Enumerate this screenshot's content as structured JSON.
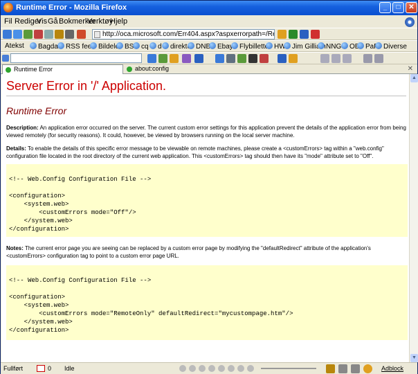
{
  "window": {
    "title": "Runtime Error - Mozilla Firefox"
  },
  "menu": [
    "Fil",
    "Rediger",
    "Vis",
    "Gå",
    "Bokmerker",
    "Verktøy",
    "Hjelp"
  ],
  "address": {
    "url": "http://oca.microsoft.com/Err404.aspx?aspxerrorpath=/ResRedir.aspx"
  },
  "bookmarks": [
    "Atekst",
    "Bagdad",
    "RSS feed",
    "Bildeler",
    "BS",
    "cq",
    "d",
    "direkte",
    "DNB",
    "Ebay",
    "Flybilletter",
    "HW",
    "Jim Gilliam",
    "NNGS",
    "OB",
    "PaP",
    "Diverse"
  ],
  "tabs": [
    {
      "label": "Runtime Error",
      "active": true
    },
    {
      "label": "about:config",
      "active": false
    }
  ],
  "page": {
    "heading": "Server Error in '/' Application.",
    "subheading": "Runtime Error",
    "description_label": "Description:",
    "description_text": "An application error occurred on the server. The current custom error settings for this application prevent the details of the application error from being viewed remotely (for security reasons). It could, however, be viewed by browsers running on the local server machine.",
    "details_label": "Details:",
    "details_text": "To enable the details of this specific error message to be viewable on remote machines, please create a <customErrors> tag within a \"web.config\" configuration file located in the root directory of the current web application. This <customErrors> tag should then have its \"mode\" attribute set to \"Off\".",
    "code1": "\n<!-- Web.Config Configuration File -->\n\n<configuration>\n    <system.web>\n        <customErrors mode=\"Off\"/>\n    </system.web>\n</configuration>",
    "notes_label": "Notes:",
    "notes_text": "The current error page you are seeing can be replaced by a custom error page by modifying the \"defaultRedirect\" attribute of the application's <customErrors> configuration tag to point to a custom error page URL.",
    "code2": "\n<!-- Web.Config Configuration File -->\n\n<configuration>\n    <system.web>\n        <customErrors mode=\"RemoteOnly\" defaultRedirect=\"mycustompage.htm\"/>\n    </system.web>\n</configuration>"
  },
  "status": {
    "text": "Fullført",
    "mail_count": "0",
    "idle": "Idle",
    "adblock": "Adblock"
  },
  "colors": {
    "heading": "#cc0000",
    "subheading": "#800000",
    "code_bg": "#ffffcc",
    "titlebar": "#0a4fd0"
  }
}
